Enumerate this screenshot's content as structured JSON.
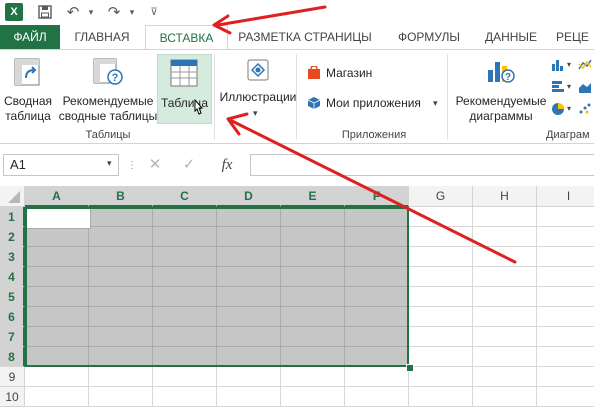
{
  "qat": {
    "logo": "X",
    "save_icon": "save-icon",
    "undo_icon": "undo-icon",
    "redo_icon": "redo-icon"
  },
  "tabs": [
    {
      "label": "ФАЙЛ"
    },
    {
      "label": "ГЛАВНАЯ"
    },
    {
      "label": "ВСТАВКА"
    },
    {
      "label": "РАЗМЕТКА СТРАНИЦЫ"
    },
    {
      "label": "ФОРМУЛЫ"
    },
    {
      "label": "ДАННЫЕ"
    },
    {
      "label": "РЕЦЕ"
    }
  ],
  "ribbon": {
    "pivot_line1": "Сводная",
    "pivot_line2": "таблица",
    "recommended_line1": "Рекомендуемые",
    "recommended_line2": "сводные таблицы",
    "table": "Таблица",
    "tables_group": "Таблицы",
    "illustrations": "Иллюстрации",
    "store": "Магазин",
    "my_apps": "Мои приложения",
    "apps_group": "Приложения",
    "rec_charts_line1": "Рекомендуемые",
    "rec_charts_line2": "диаграммы",
    "charts_group": "Диаграм"
  },
  "formula_bar": {
    "name_box": "A1",
    "cancel": "✕",
    "enter": "✓",
    "fx": "fx",
    "value": ""
  },
  "grid": {
    "columns": [
      "A",
      "B",
      "C",
      "D",
      "E",
      "F",
      "G",
      "H",
      "I"
    ],
    "rows": [
      "1",
      "2",
      "3",
      "4",
      "5",
      "6",
      "7",
      "8",
      "9",
      "10"
    ]
  },
  "colors": {
    "accent": "#217346",
    "selection": "#c6c6c6",
    "arrow": "#e02020"
  }
}
